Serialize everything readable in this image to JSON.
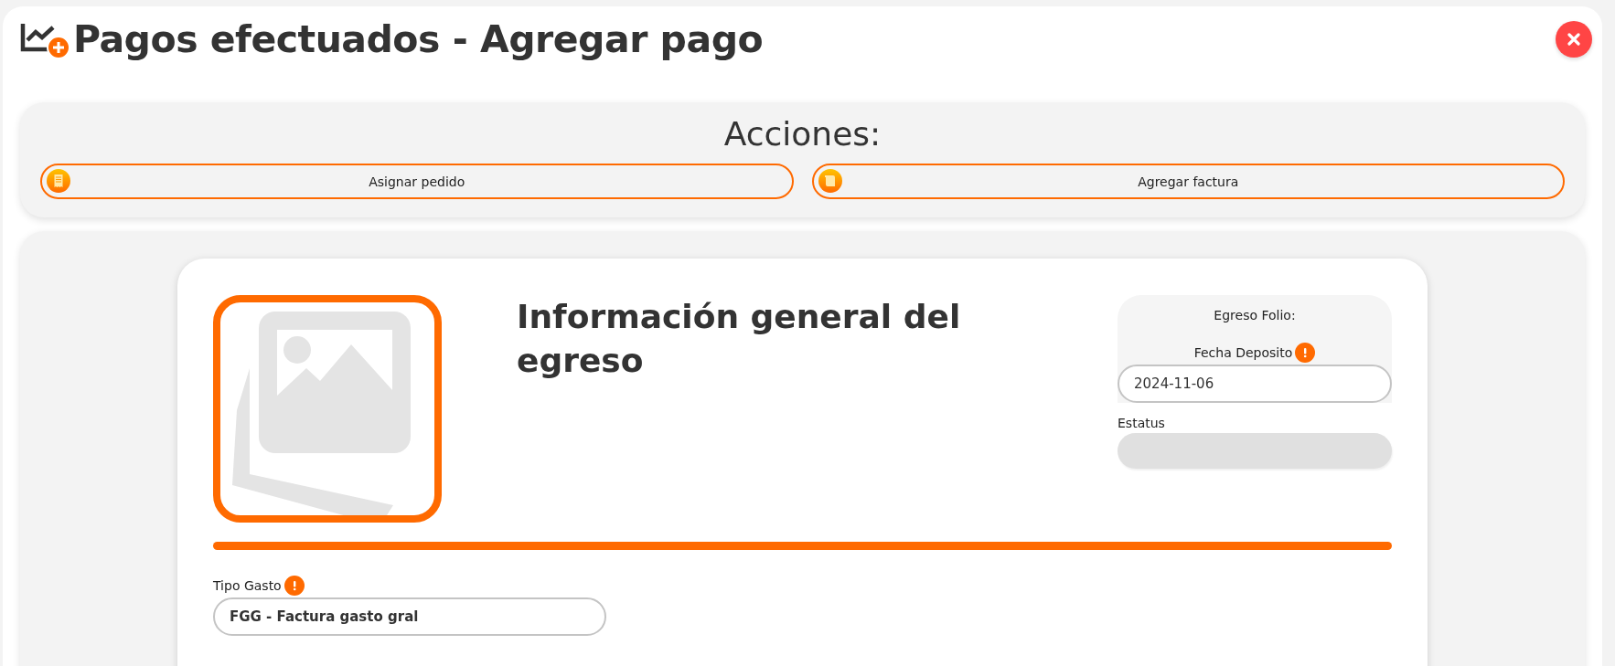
{
  "window": {
    "title": "Pagos efectuados - Agregar pago"
  },
  "actions": {
    "heading": "Acciones:",
    "buttons": [
      {
        "kind": "receipt",
        "label": "Asignar pedido"
      },
      {
        "kind": "note",
        "label": "Agregar factura"
      }
    ]
  },
  "card": {
    "heading": "Información general del egreso",
    "folio_label": "Egreso Folio:",
    "fecha": {
      "label": "Fecha Deposito",
      "required": true,
      "value": "2024-11-06"
    },
    "estatus": {
      "label": "Estatus",
      "disabled": true
    },
    "tipo_gasto": {
      "label": "Tipo Gasto",
      "required": true,
      "value": "FGG - Factura gasto gral"
    }
  }
}
